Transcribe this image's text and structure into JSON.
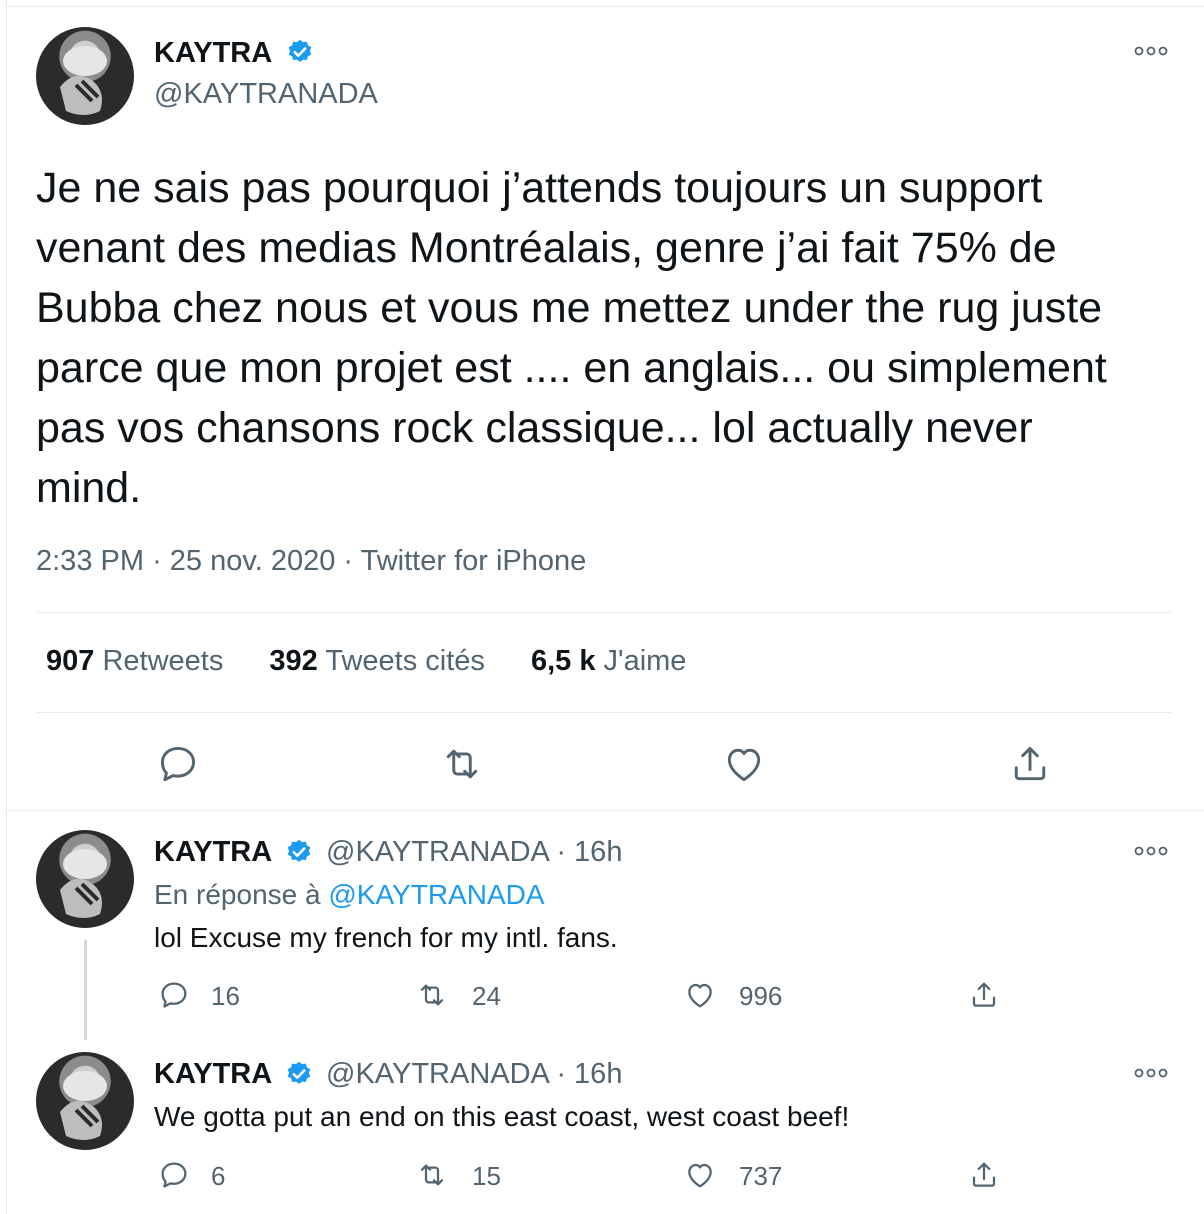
{
  "main_tweet": {
    "display_name": "KAYTRA",
    "handle": "@KAYTRANADA",
    "text": "Je ne sais pas pourquoi j’attends toujours un support\nvenant des medias Montréalais, genre j’ai fait 75% de\nBubba chez nous et vous me mettez under the rug juste\nparce que mon projet est .... en anglais... ou simplement\npas vos chansons rock classique... lol actually never\nmind.",
    "time": "2:33 PM",
    "date": "25 nov. 2020",
    "source": "Twitter for iPhone",
    "meta_separator": "·",
    "stats": {
      "retweets_count": "907",
      "retweets_label": "Retweets",
      "quotes_count": "392",
      "quotes_label": "Tweets cités",
      "likes_count": "6,5 k",
      "likes_label": "J'aime"
    }
  },
  "replies": [
    {
      "display_name": "KAYTRA",
      "handle_time": "@KAYTRANADA · 16h",
      "in_reply_prefix": "En réponse à",
      "in_reply_to": "@KAYTRANADA",
      "text": "lol Excuse my french for my intl. fans.",
      "reply_count": "16",
      "retweet_count": "24",
      "like_count": "996"
    },
    {
      "display_name": "KAYTRA",
      "handle_time": "@KAYTRANADA · 16h",
      "text": "We gotta put an end on this east coast, west coast beef!",
      "reply_count": "6",
      "retweet_count": "15",
      "like_count": "737"
    }
  ],
  "icons": {
    "more": "more-icon",
    "verified": "verified-badge-icon",
    "reply": "reply-icon",
    "retweet": "retweet-icon",
    "like": "heart-icon",
    "share": "share-icon"
  },
  "colors": {
    "verified_blue": "#1d9bf0",
    "text_primary": "#0f1419",
    "text_secondary": "#536471",
    "link": "#1d9bf0",
    "border": "#e6ecf0"
  }
}
